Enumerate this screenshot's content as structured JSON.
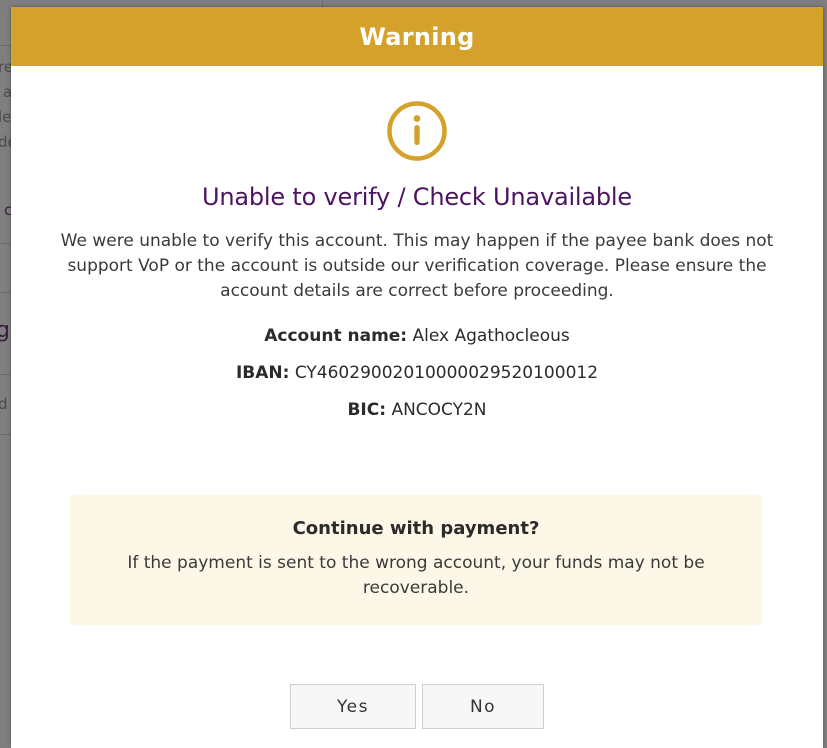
{
  "colors": {
    "header_bg": "#d4a12a",
    "title_color": "#4d1460",
    "icon_color": "#d4a12a",
    "confirm_bg": "#fdf7e7"
  },
  "background_page": {
    "fragments": [
      "re",
      "a",
      "le",
      "de",
      "c",
      "g",
      "d"
    ]
  },
  "modal": {
    "header": "Warning",
    "icon": "info-circle-icon",
    "title": "Unable to verify / Check Unavailable",
    "message": "We were unable to verify this account. This may happen if the payee bank does not support VoP or the account is outside our verification coverage. Please ensure the account details are correct before proceeding.",
    "details": [
      {
        "label": "Account name:",
        "value": "Alex Agathocleous"
      },
      {
        "label": "IBAN:",
        "value": "CY46029002010000029520100012"
      },
      {
        "label": "BIC:",
        "value": "ANCOCY2N"
      }
    ],
    "confirm": {
      "title": "Continue with payment?",
      "text": "If the payment is sent to the wrong account, your funds may not be recoverable."
    },
    "buttons": {
      "yes": "Yes",
      "no": "No"
    }
  }
}
